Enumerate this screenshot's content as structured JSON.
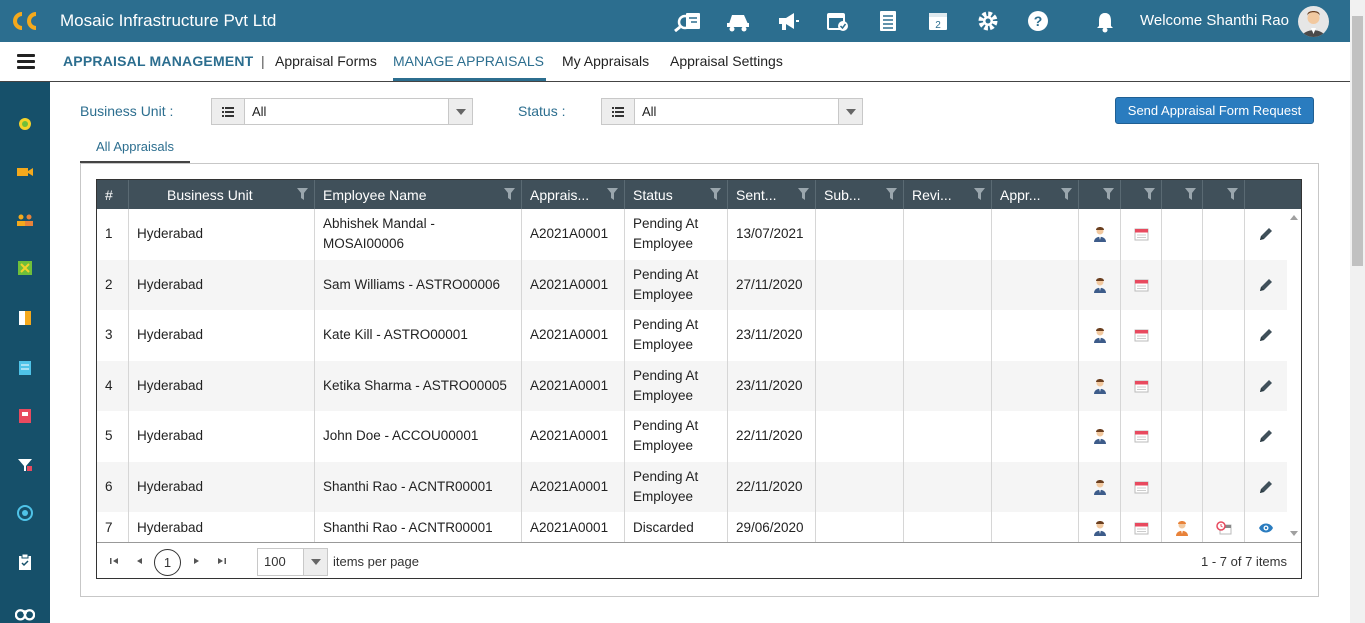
{
  "header": {
    "company": "Mosaic Infrastructure Pvt Ltd",
    "welcome": "Welcome Shanthi Rao",
    "icons": [
      "search-report-icon",
      "transport-icon",
      "announcement-icon",
      "calendar-check-icon",
      "document-list-icon",
      "calendar-date-icon",
      "gear-icon",
      "help-icon",
      "bell-icon"
    ]
  },
  "nav": {
    "title": "APPRAISAL MANAGEMENT",
    "separator": "|",
    "items": [
      "Appraisal Forms",
      "MANAGE APPRAISALS",
      "My Appraisals",
      "Appraisal Settings"
    ]
  },
  "filters": {
    "business_unit_label": "Business Unit :",
    "business_unit_value": "All",
    "status_label": "Status :",
    "status_value": "All",
    "send_button": "Send Appraisal Form Request"
  },
  "tab": {
    "label": "All Appraisals"
  },
  "grid": {
    "columns": [
      "#",
      "Business Unit",
      "Employee Name",
      "Apprais...",
      "Status",
      "Sent...",
      "Sub...",
      "Revi...",
      "Appr..."
    ],
    "rows": [
      {
        "num": "1",
        "bu": "Hyderabad",
        "emp": "Abhishek Mandal - MOSAI00006",
        "code": "A2021A0001",
        "status": "Pending At Employee",
        "sent": "13/07/2021",
        "discarded": false
      },
      {
        "num": "2",
        "bu": "Hyderabad",
        "emp": "Sam Williams - ASTRO00006",
        "code": "A2021A0001",
        "status": "Pending At Employee",
        "sent": "27/11/2020",
        "discarded": false
      },
      {
        "num": "3",
        "bu": "Hyderabad",
        "emp": "Kate Kill - ASTRO00001",
        "code": "A2021A0001",
        "status": "Pending At Employee",
        "sent": "23/11/2020",
        "discarded": false
      },
      {
        "num": "4",
        "bu": "Hyderabad",
        "emp": "Ketika Sharma - ASTRO00005",
        "code": "A2021A0001",
        "status": "Pending At Employee",
        "sent": "23/11/2020",
        "discarded": false
      },
      {
        "num": "5",
        "bu": "Hyderabad",
        "emp": "John Doe - ACCOU00001",
        "code": "A2021A0001",
        "status": "Pending At Employee",
        "sent": "22/11/2020",
        "discarded": false
      },
      {
        "num": "6",
        "bu": "Hyderabad",
        "emp": "Shanthi Rao - ACNTR00001",
        "code": "A2021A0001",
        "status": "Pending At Employee",
        "sent": "22/11/2020",
        "discarded": false
      },
      {
        "num": "7",
        "bu": "Hyderabad",
        "emp": "Shanthi Rao - ACNTR00001",
        "code": "A2021A0001",
        "status": "Discarded",
        "sent": "29/06/2020",
        "discarded": true
      }
    ]
  },
  "pager": {
    "current_page": "1",
    "per_page": "100",
    "per_page_label": "items per page",
    "range": "1 - 7 of 7 items"
  },
  "colors": {
    "topbar": "#2c6e8f",
    "sidebar": "#16506a",
    "accent": "#2c6e8f",
    "header": "#40505a",
    "button": "#2a7cbf"
  }
}
